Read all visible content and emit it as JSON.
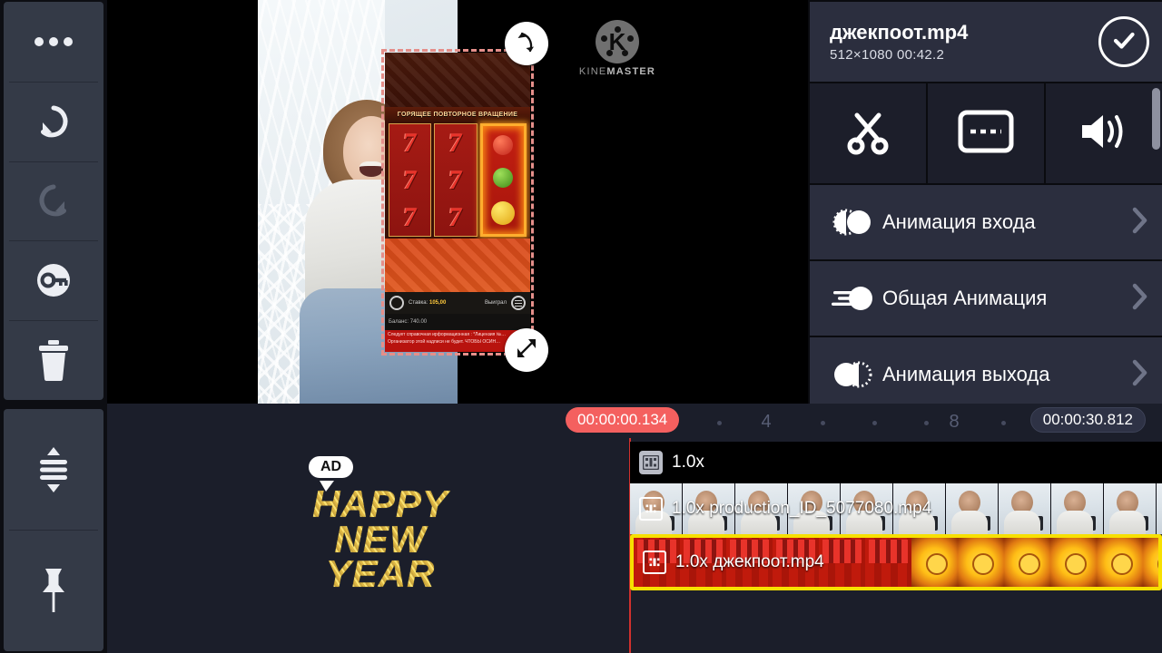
{
  "left_rail": {
    "items": [
      {
        "name": "more-options",
        "icon": "ellipsis-icon"
      },
      {
        "name": "undo",
        "icon": "undo-icon"
      },
      {
        "name": "redo",
        "icon": "redo-icon"
      },
      {
        "name": "lock",
        "icon": "key-icon"
      },
      {
        "name": "delete",
        "icon": "trash-icon"
      },
      {
        "name": "expand-tracks",
        "icon": "expand-vertical-icon"
      },
      {
        "name": "pin",
        "icon": "pin-icon"
      }
    ]
  },
  "preview": {
    "watermark": {
      "letter": "K",
      "text_light": "KINE",
      "text_bold": "MASTER"
    },
    "overlay_clip": {
      "banner_text": "ГОРЯЩЕЕ ПОВТОРНОЕ ВРАЩЕНИЕ",
      "reel_symbol": "7",
      "bet_label": "Ставка:",
      "bet_value": "105,00",
      "spin_label": "Выиграл",
      "balance_text": "Баланс: 740.00",
      "legal_text": "Следует справочная ирформационная : *Лицензия №… Организатор этой надписи не будет. ЧТОБЫ ОСИН…"
    },
    "handles": {
      "rotate": "rotate-handle-icon",
      "resize": "resize-handle-icon"
    },
    "fullscreen_button": "fullscreen-icon"
  },
  "options_panel": {
    "title": "джекпоот.mp4",
    "subtitle": "512×1080  00:42.2",
    "done_button": "checkmark-icon",
    "tools": [
      {
        "name": "trim-split",
        "icon": "scissors-icon"
      },
      {
        "name": "captions",
        "icon": "caption-icon"
      },
      {
        "name": "volume",
        "icon": "volume-icon"
      }
    ],
    "rows": [
      {
        "label": "Анимация входа",
        "icon": "animation-in-icon"
      },
      {
        "label": "Общая Анимация",
        "icon": "animation-overall-icon"
      },
      {
        "label": "Анимация выхода",
        "icon": "animation-out-icon"
      }
    ],
    "chevron": "chevron-right-icon"
  },
  "timeline": {
    "current_time": "00:00:00.134",
    "total_time": "00:00:30.812",
    "ruler_labels": [
      "4",
      "8"
    ],
    "tracks": [
      {
        "name": "speed-track",
        "label": "1.0x"
      },
      {
        "name": "video-track",
        "label": "1.0x production_ID_5077080.mp4"
      },
      {
        "name": "overlay-track",
        "label": "1.0x джекпоот.mp4",
        "selected": true
      }
    ]
  },
  "ad_overlay": {
    "badge": "AD",
    "line1": "HAPPY",
    "line2": "NEW",
    "line3": "YEAR"
  },
  "colors": {
    "accent_red": "#f4605f",
    "selection_yellow": "#f7e000",
    "panel_bg": "#2b2e3e",
    "timeline_bg": "#1b1e2a"
  }
}
